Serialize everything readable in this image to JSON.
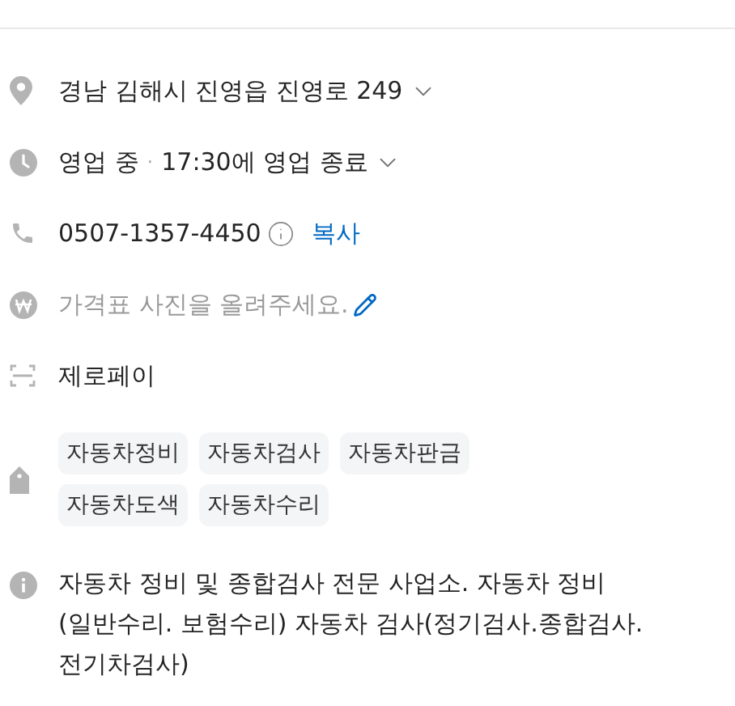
{
  "address": {
    "text": "경남 김해시 진영읍 진영로 249",
    "expanded": false
  },
  "hours": {
    "status": "영업 중",
    "separator": "·",
    "detail": "17:30에 영업 종료",
    "expanded": false
  },
  "phone": {
    "number": "0507-1357-4450",
    "copy_link": "복사"
  },
  "price": {
    "prompt": "가격표 사진을 올려주세요."
  },
  "payment": {
    "text": "제로페이"
  },
  "tags": [
    "자동차정비",
    "자동차검사",
    "자동차판금",
    "자동차도색",
    "자동차수리"
  ],
  "description": "자동차 정비 및 종합검사 전문 사업소. 자동차 정비 (일반수리. 보험수리) 자동차 검사(정기검사.종합검사.전기차검사)"
}
